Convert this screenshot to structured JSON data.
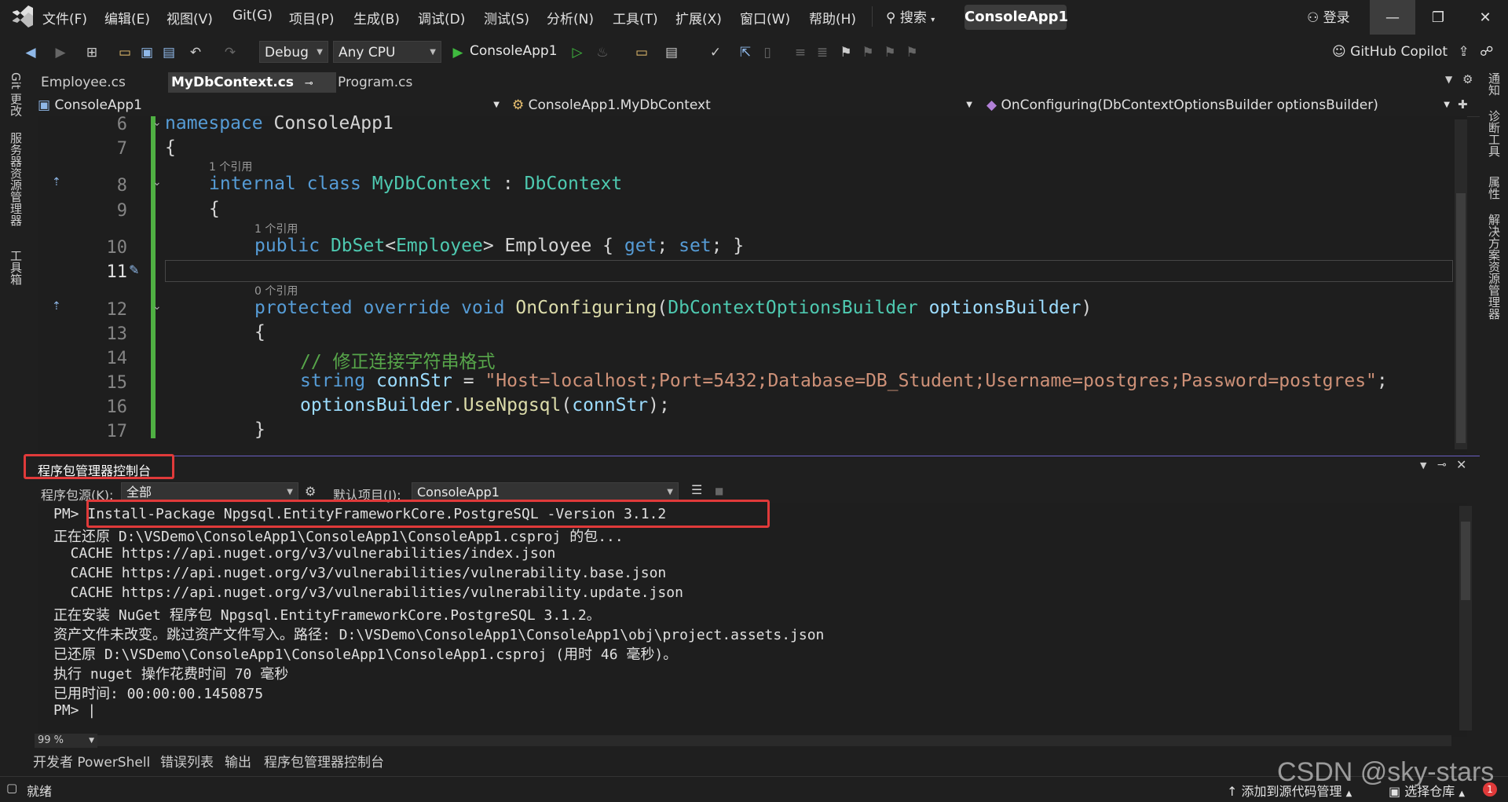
{
  "menu": {
    "items": [
      "文件(F)",
      "编辑(E)",
      "视图(V)",
      "Git(G)",
      "项目(P)",
      "生成(B)",
      "调试(D)",
      "测试(S)",
      "分析(N)",
      "工具(T)",
      "扩展(X)",
      "窗口(W)",
      "帮助(H)"
    ],
    "search_label": "搜索",
    "app_name": "ConsoleApp1",
    "login_label": "登录"
  },
  "toolbar": {
    "config": "Debug",
    "platform": "Any CPU",
    "run_target": "ConsoleApp1",
    "copilot": "GitHub Copilot"
  },
  "side_rails": {
    "left": [
      "Git 更改",
      "服务器资源管理器",
      "工具箱"
    ],
    "right": [
      "通知",
      "诊断工具",
      "属性",
      "解决方案资源管理器"
    ]
  },
  "tabs": [
    "Employee.cs",
    "MyDbContext.cs",
    "Program.cs"
  ],
  "navbar": {
    "project": "ConsoleApp1",
    "class": "ConsoleApp1.MyDbContext",
    "member": "OnConfiguring(DbContextOptionsBuilder optionsBuilder)"
  },
  "editor": {
    "line_numbers": [
      "6",
      "7",
      "8",
      "9",
      "10",
      "11",
      "12",
      "13",
      "14",
      "15",
      "16",
      "17"
    ],
    "codelens": [
      "1 个引用",
      "1 个引用",
      "0 个引用"
    ],
    "code": {
      "l6_kw": "namespace",
      "l6_name": " ConsoleApp1",
      "l7": "{",
      "l8_kw1": "internal",
      "l8_kw2": "class",
      "l8_name": "MyDbContext",
      "l8_colon": " : ",
      "l8_base": "DbContext",
      "l9": "{",
      "l10_kw": "public",
      "l10_ty1": "DbSet",
      "l10_lt": "<",
      "l10_ty2": "Employee",
      "l10_rest": "> Employee { ",
      "l10_get": "get",
      "l10_semi1": "; ",
      "l10_set": "set",
      "l10_end": "; }",
      "l12_kw1": "protected",
      "l12_kw2": "override",
      "l12_kw3": "void",
      "l12_fn": "OnConfiguring",
      "l12_paren": "(",
      "l12_ty": "DbContextOptionsBuilder",
      "l12_pm": "optionsBuilder",
      "l12_close": ")",
      "l13": "{",
      "l14_comment": "// 修正连接字符串格式",
      "l15_kw": "string",
      "l15_var": "connStr",
      "l15_eq": " = ",
      "l15_str": "\"Host=localhost;Port=5432;Database=DB_Student;Username=postgres;Password=postgres\"",
      "l15_semi": ";",
      "l16_obj": "optionsBuilder",
      "l16_dot": ".",
      "l16_fn": "UseNpgsql",
      "l16_open": "(",
      "l16_arg": "connStr",
      "l16_close": ");",
      "l17": "}"
    }
  },
  "console_panel": {
    "title": "程序包管理器控制台",
    "source_label": "程序包源(K):",
    "source_value": "全部",
    "default_project_label": "默认项目(J):",
    "default_project_value": "ConsoleApp1",
    "lines": [
      "PM> ",
      "正在还原 D:\\VSDemo\\ConsoleApp1\\ConsoleApp1\\ConsoleApp1.csproj 的包...",
      "  CACHE https://api.nuget.org/v3/vulnerabilities/index.json",
      "  CACHE https://api.nuget.org/v3/vulnerabilities/vulnerability.base.json",
      "  CACHE https://api.nuget.org/v3/vulnerabilities/vulnerability.update.json",
      "正在安装 NuGet 程序包 Npgsql.EntityFrameworkCore.PostgreSQL 3.1.2。",
      "资产文件未改变。跳过资产文件写入。路径: D:\\VSDemo\\ConsoleApp1\\ConsoleApp1\\obj\\project.assets.json",
      "已还原 D:\\VSDemo\\ConsoleApp1\\ConsoleApp1\\ConsoleApp1.csproj (用时 46 毫秒)。",
      "执行 nuget 操作花费时间 70 毫秒",
      "已用时间: 00:00:00.1450875",
      "PM> |"
    ],
    "command": "Install-Package Npgsql.EntityFrameworkCore.PostgreSQL -Version 3.1.2",
    "zoom": "99 %"
  },
  "bottom_tabs": [
    "开发者 PowerShell",
    "错误列表",
    "输出",
    "程序包管理器控制台"
  ],
  "status": {
    "ready": "就绪",
    "add_source": "添加到源代码管理",
    "select_repo": "选择仓库",
    "notifications": "1"
  },
  "watermark": "CSDN @sky-stars",
  "colors": {
    "keyword": "#569cd6",
    "type": "#4ec9b0",
    "function": "#dcdcaa",
    "parameter": "#9cdcfe",
    "string": "#ce9178",
    "comment": "#57a64a",
    "annotation_red": "#e03a3a",
    "change_bar": "#4fb043"
  }
}
